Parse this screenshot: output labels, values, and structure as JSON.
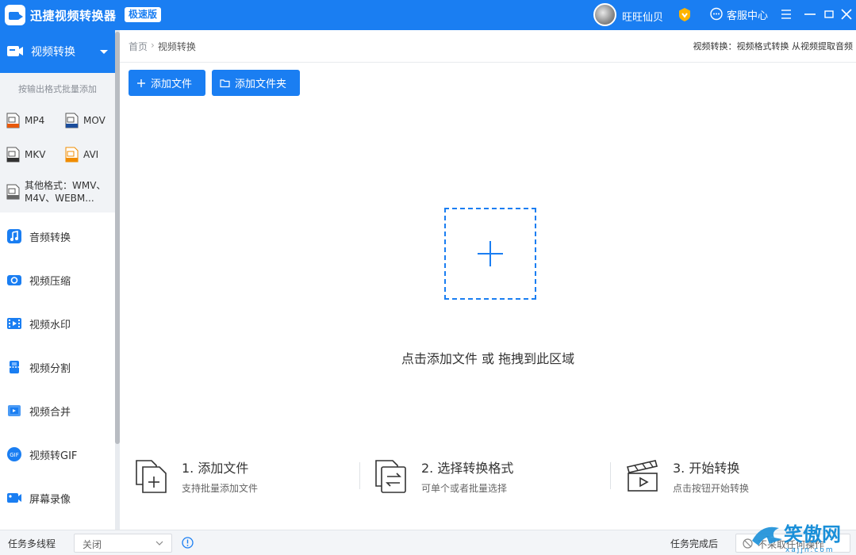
{
  "titlebar": {
    "app_title": "迅捷视频转换器",
    "badge": "极速版",
    "username": "旺旺仙贝",
    "service_label": "客服中心"
  },
  "sidebar": {
    "active": {
      "label": "视频转换",
      "icon": "video-convert-icon"
    },
    "format_hint": "按输出格式批量添加",
    "formats": [
      {
        "label": "MP4",
        "icon_color": "#e8590c"
      },
      {
        "label": "MOV",
        "icon_color": "#1c4e9c"
      },
      {
        "label": "MKV",
        "icon_color": "#333333"
      },
      {
        "label": "AVI",
        "icon_color": "#f08c00"
      }
    ],
    "other_formats": "其他格式：WMV、M4V、WEBM...",
    "items": [
      {
        "label": "音频转换",
        "icon": "audio-convert-icon"
      },
      {
        "label": "视频压缩",
        "icon": "video-compress-icon"
      },
      {
        "label": "视频水印",
        "icon": "video-watermark-icon"
      },
      {
        "label": "视频分割",
        "icon": "video-split-icon"
      },
      {
        "label": "视频合并",
        "icon": "video-merge-icon"
      },
      {
        "label": "视频转GIF",
        "icon": "video-to-gif-icon"
      },
      {
        "label": "屏幕录像",
        "icon": "screen-record-icon"
      }
    ]
  },
  "main": {
    "breadcrumb": {
      "home": "首页",
      "sep": "›",
      "current": "视频转换"
    },
    "header_desc": "视频转换：视频格式转换 从视频提取音频",
    "add_file": "添加文件",
    "add_folder": "添加文件夹",
    "drop_text": "点击添加文件 或 拖拽到此区域",
    "steps": [
      {
        "title": "1. 添加文件",
        "sub": "支持批量添加文件"
      },
      {
        "title": "2. 选择转换格式",
        "sub": "可单个或者批量选择"
      },
      {
        "title": "3. 开始转换",
        "sub": "点击按钮开始转换"
      }
    ]
  },
  "bottombar": {
    "thread_label": "任务多线程",
    "thread_value": "关闭",
    "after_label": "任务完成后",
    "after_value": "不采取任何操作"
  },
  "watermark": {
    "text": "笑傲网",
    "sub": "xajjn.com"
  },
  "colors": {
    "accent": "#1a7ef2",
    "sidebar_panel": "#f1f3f6"
  }
}
